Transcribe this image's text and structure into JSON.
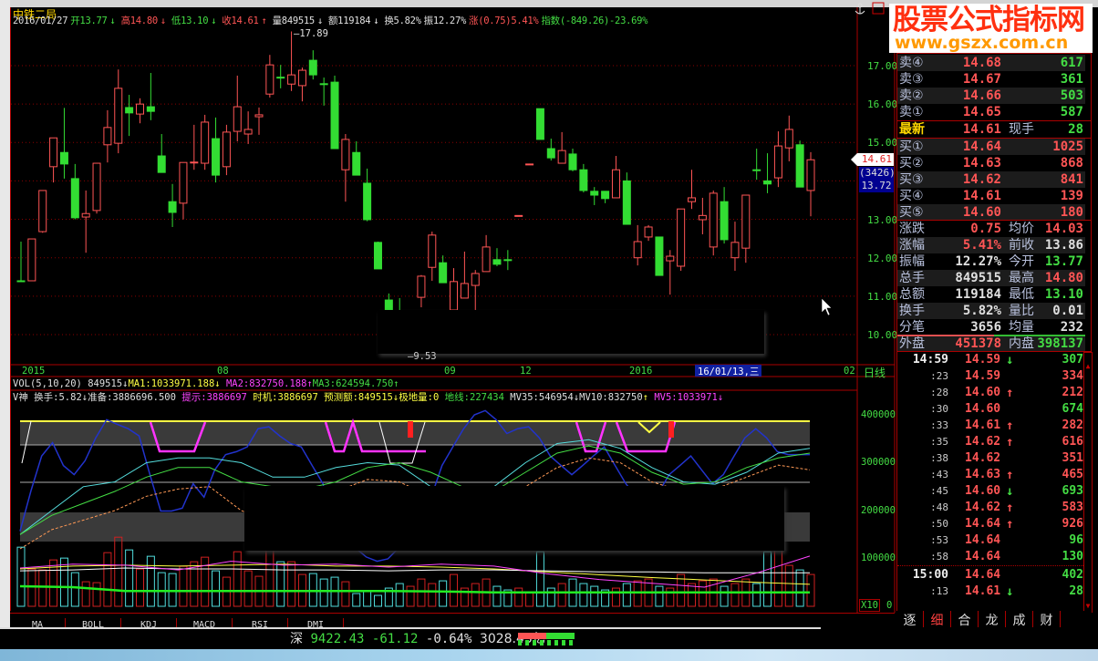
{
  "stock": {
    "name": "中铁二局"
  },
  "info": {
    "date": "2016/01/27",
    "open": "开13.77",
    "open_arrow": "↓",
    "high": "高14.80",
    "high_arrow": "↓",
    "low": "低13.10",
    "low_arrow": "↓",
    "close": "收14.61",
    "close_arrow": "↑",
    "vol": "量849515",
    "vol_arrow": "↓",
    "amt": "额119184",
    "amt_arrow": "↓",
    "turn": "换5.82%",
    "amp": "振12.27%",
    "chg": "涨(0.75)5.41%",
    "index": "指数(-849.26)-23.69%"
  },
  "price_axis": [
    "17.00",
    "16.00",
    "15.00",
    "13.00",
    "12.00",
    "11.00",
    "10.00"
  ],
  "price_tag": "14.61",
  "blue_tag": {
    "count": "(3426)",
    "price": "13.72"
  },
  "hi_label": "17.89",
  "lo_label": "9.53",
  "date_axis": [
    "2015",
    "08",
    "09",
    "12",
    "2016",
    "02"
  ],
  "date_selected": "16/01/13,三",
  "period": "日线",
  "vol_line": {
    "name": "VOL(5,10,20)",
    "value": "849515",
    "arrow": "↓",
    "ma1": "MA1:1033971.188",
    "ma1_arrow": "↓",
    "ma2": "MA2:832750.188",
    "ma2_arrow": "↑",
    "ma3": "MA3:624594.750",
    "ma3_arrow": "↑"
  },
  "ind_line": {
    "name": "V神",
    "turn": "换手:5.82",
    "turn_arrow": "↓",
    "prep": "准备:3886696.500",
    "hint": "提示:3886697",
    "timing": "时机:3886697",
    "forecast": "预测额:849515",
    "forecast_arrow": "↓",
    "extreme": "极地量:0",
    "ground": "地线:227434",
    "mv35": "MV35:546954",
    "mv35_arrow": "↓",
    "mv10": "MV10:832750",
    "mv10_arrow": "↑",
    "mv5": "MV5:1033971",
    "mv5_arrow": "↓"
  },
  "vol_axis": [
    "400000",
    "300000",
    "200000",
    "100000",
    "0"
  ],
  "vol_multiplier": "X10",
  "bottom_tabs": [
    "MA",
    "BOLL",
    "KDJ",
    "MACD",
    "RSI",
    "DMI"
  ],
  "status": {
    "market": "深",
    "index": "9422.43",
    "change": "-61.12",
    "pct": "-0.64%",
    "amount": "3028.43亿"
  },
  "logo": {
    "title": "股票公式指标网",
    "url": "www.gszx.com.cn"
  },
  "quote": {
    "asks": [
      {
        "label": "卖④",
        "price": "14.68",
        "vol": "617"
      },
      {
        "label": "卖③",
        "price": "14.67",
        "vol": "361"
      },
      {
        "label": "卖②",
        "price": "14.66",
        "vol": "503"
      },
      {
        "label": "卖①",
        "price": "14.65",
        "vol": "587"
      }
    ],
    "last": {
      "label": "最新",
      "price": "14.61",
      "label2": "现手",
      "vol": "28"
    },
    "bids": [
      {
        "label": "买①",
        "price": "14.64",
        "vol": "1025"
      },
      {
        "label": "买②",
        "price": "14.63",
        "vol": "868"
      },
      {
        "label": "买③",
        "price": "14.62",
        "vol": "841"
      },
      {
        "label": "买④",
        "price": "14.61",
        "vol": "139"
      },
      {
        "label": "买⑤",
        "price": "14.60",
        "vol": "180"
      }
    ],
    "stats": [
      {
        "l1": "涨跌",
        "v1": "0.75",
        "c1": "r",
        "l2": "均价",
        "v2": "14.03",
        "c2": "r"
      },
      {
        "l1": "涨幅",
        "v1": "5.41%",
        "c1": "r",
        "l2": "前收",
        "v2": "13.86",
        "c2": "w"
      },
      {
        "l1": "振幅",
        "v1": "12.27%",
        "c1": "w",
        "l2": "今开",
        "v2": "13.77",
        "c2": "g"
      },
      {
        "l1": "总手",
        "v1": "849515",
        "c1": "w",
        "l2": "最高",
        "v2": "14.80",
        "c2": "r"
      },
      {
        "l1": "总额",
        "v1": "119184",
        "c1": "w",
        "l2": "最低",
        "v2": "13.10",
        "c2": "g"
      },
      {
        "l1": "换手",
        "v1": "5.82%",
        "c1": "w",
        "l2": "量比",
        "v2": "0.01",
        "c2": "w"
      },
      {
        "l1": "分笔",
        "v1": "3656",
        "c1": "w",
        "l2": "均量",
        "v2": "232",
        "c2": "w"
      },
      {
        "l1": "外盘",
        "v1": "451378",
        "c1": "r",
        "l2": "内盘",
        "v2": "398137",
        "c2": "g"
      }
    ]
  },
  "ticks": [
    {
      "time": "14:59",
      "price": "14.59",
      "arrow": "↓",
      "vol": "307",
      "dir": "g"
    },
    {
      "time": ":23",
      "price": "14.59",
      "arrow": "",
      "vol": "334",
      "dir": "r"
    },
    {
      "time": ":28",
      "price": "14.60",
      "arrow": "↑",
      "vol": "212",
      "dir": "r"
    },
    {
      "time": ":30",
      "price": "14.60",
      "arrow": "",
      "vol": "674",
      "dir": "g"
    },
    {
      "time": ":33",
      "price": "14.61",
      "arrow": "↑",
      "vol": "282",
      "dir": "r"
    },
    {
      "time": ":35",
      "price": "14.62",
      "arrow": "↑",
      "vol": "616",
      "dir": "r"
    },
    {
      "time": ":38",
      "price": "14.62",
      "arrow": "",
      "vol": "351",
      "dir": "r"
    },
    {
      "time": ":43",
      "price": "14.63",
      "arrow": "↑",
      "vol": "465",
      "dir": "r"
    },
    {
      "time": ":45",
      "price": "14.60",
      "arrow": "↓",
      "vol": "693",
      "dir": "g"
    },
    {
      "time": ":48",
      "price": "14.62",
      "arrow": "↑",
      "vol": "583",
      "dir": "r"
    },
    {
      "time": ":50",
      "price": "14.64",
      "arrow": "↑",
      "vol": "926",
      "dir": "r"
    },
    {
      "time": ":53",
      "price": "14.64",
      "arrow": "",
      "vol": "96",
      "dir": "g"
    },
    {
      "time": ":58",
      "price": "14.64",
      "arrow": "",
      "vol": "130",
      "dir": "g"
    },
    {
      "time": "15:00",
      "price": "14.64",
      "arrow": "",
      "vol": "402",
      "dir": "g"
    },
    {
      "time": ":13",
      "price": "14.61",
      "arrow": "↓",
      "vol": "28",
      "dir": "g"
    }
  ],
  "right_tabs": [
    "逐",
    "细",
    "合",
    "龙",
    "成",
    "财"
  ],
  "colors": {
    "up": "#ff5555",
    "down": "#33dd33",
    "bg": "#000000",
    "grid": "#8a0000"
  },
  "chart_data": {
    "type": "candlestick",
    "ohlc": [
      [
        11.4,
        12.42,
        11.38,
        11.38
      ],
      [
        11.4,
        12.49,
        11.4,
        12.49
      ],
      [
        12.68,
        13.75,
        12.65,
        13.75
      ],
      [
        14.37,
        15.12,
        13.96,
        15.12
      ],
      [
        14.74,
        15.9,
        14.06,
        14.44
      ],
      [
        14.06,
        14.44,
        13.0,
        13.04
      ],
      [
        13.06,
        13.75,
        12.13,
        13.15
      ],
      [
        13.23,
        14.46,
        13.15,
        14.46
      ],
      [
        14.94,
        15.84,
        14.48,
        15.39
      ],
      [
        14.98,
        16.9,
        14.72,
        16.41
      ],
      [
        15.91,
        16.24,
        15.17,
        15.77
      ],
      [
        15.74,
        16.15,
        15.5,
        16.0
      ],
      [
        15.93,
        16.81,
        15.58,
        15.81
      ],
      [
        14.65,
        15.22,
        14.22,
        14.22
      ],
      [
        13.46,
        13.92,
        12.8,
        13.18
      ],
      [
        13.42,
        14.48,
        13.0,
        14.48
      ],
      [
        14.47,
        15.46,
        14.29,
        14.49
      ],
      [
        14.46,
        15.72,
        14.29,
        15.53
      ],
      [
        15.1,
        15.65,
        13.96,
        14.15
      ],
      [
        14.37,
        15.46,
        14.15,
        15.27
      ],
      [
        15.29,
        16.74,
        15.03,
        15.93
      ],
      [
        15.22,
        15.81,
        14.96,
        15.34
      ],
      [
        15.67,
        15.91,
        15.2,
        15.72
      ],
      [
        16.26,
        17.28,
        16.17,
        17.02
      ],
      [
        16.7,
        17.02,
        16.41,
        16.69
      ],
      [
        16.52,
        17.89,
        16.34,
        16.76
      ],
      [
        16.48,
        16.95,
        16.07,
        16.88
      ],
      [
        17.14,
        17.4,
        16.64,
        16.76
      ],
      [
        16.53,
        16.69,
        15.96,
        16.52
      ],
      [
        16.57,
        16.74,
        14.84,
        14.84
      ],
      [
        14.29,
        15.22,
        13.46,
        15.08
      ],
      [
        14.74,
        15.03,
        14.15,
        14.15
      ],
      [
        13.94,
        14.32,
        12.95,
        12.99
      ],
      [
        12.4,
        12.42,
        11.71,
        11.71
      ],
      [
        10.9,
        11.07,
        10.0,
        10.2
      ],
      [
        10.3,
        10.95,
        9.8,
        9.9
      ],
      [
        9.9,
        10.5,
        9.53,
        10.4
      ],
      [
        10.97,
        11.55,
        10.71,
        11.52
      ],
      [
        11.75,
        12.68,
        11.4,
        12.59
      ],
      [
        11.87,
        12.06,
        11.35,
        11.35
      ],
      [
        10.64,
        11.73,
        10.64,
        11.38
      ],
      [
        10.95,
        12.16,
        10.95,
        11.33
      ],
      [
        11.28,
        11.68,
        10.64,
        11.59
      ],
      [
        11.64,
        12.59,
        11.64,
        12.28
      ],
      [
        11.95,
        12.25,
        11.78,
        11.83
      ],
      [
        11.95,
        12.2,
        11.68,
        11.94
      ],
      [
        13.1,
        13.1,
        13.1,
        13.1
      ],
      [
        14.44,
        14.44,
        14.44,
        14.44
      ],
      [
        15.88,
        15.88,
        15.08,
        15.08
      ],
      [
        14.84,
        15.1,
        14.53,
        14.6
      ],
      [
        14.46,
        15.27,
        14.46,
        14.79
      ],
      [
        14.7,
        14.84,
        14.25,
        14.29
      ],
      [
        14.29,
        14.44,
        13.7,
        13.75
      ],
      [
        13.73,
        13.84,
        13.37,
        13.63
      ],
      [
        13.73,
        13.73,
        13.42,
        13.54
      ],
      [
        13.56,
        14.65,
        13.56,
        14.29
      ],
      [
        14.0,
        14.22,
        12.87,
        12.87
      ],
      [
        12.0,
        12.85,
        11.8,
        12.42
      ],
      [
        12.54,
        12.85,
        12.44,
        12.8
      ],
      [
        12.54,
        12.54,
        11.54,
        11.54
      ],
      [
        11.92,
        12.2,
        11.04,
        12.04
      ],
      [
        11.78,
        13.27,
        11.66,
        13.27
      ],
      [
        13.46,
        14.29,
        13.27,
        13.56
      ],
      [
        12.99,
        13.56,
        12.61,
        13.1
      ],
      [
        12.28,
        13.75,
        12.06,
        13.68
      ],
      [
        13.46,
        13.84,
        12.37,
        12.47
      ],
      [
        12.0,
        12.94,
        11.66,
        12.4
      ],
      [
        12.25,
        13.63,
        11.87,
        13.63
      ],
      [
        14.29,
        14.84,
        14.03,
        14.28
      ],
      [
        14.0,
        14.72,
        13.68,
        13.92
      ],
      [
        14.08,
        15.29,
        13.84,
        14.91
      ],
      [
        14.86,
        15.7,
        14.51,
        15.34
      ],
      [
        14.94,
        15.05,
        13.84,
        13.84
      ],
      [
        13.75,
        14.75,
        13.08,
        14.55
      ]
    ],
    "ylim": [
      9.5,
      17.9
    ],
    "volume": [
      123500,
      77900,
      76000,
      96900,
      100700,
      70300,
      51300,
      49400,
      112100,
      144400,
      117800,
      77900,
      104500,
      70300,
      68400,
      83600,
      93100,
      102600,
      74100,
      60800,
      114000,
      74100,
      62700,
      117800,
      93100,
      93100,
      66500,
      68400,
      57000,
      60800,
      51300,
      26600,
      32300,
      22800,
      38000,
      47500,
      41800,
      57000,
      47500,
      53200,
      66500,
      38000,
      47500,
      57000,
      41800,
      34200,
      38000,
      28500,
      114000,
      38000,
      47500,
      57000,
      47500,
      41800,
      34200,
      38000,
      47500,
      53200,
      57000,
      41800,
      38000,
      66500,
      47500,
      53200,
      57000,
      41800,
      47500,
      57000,
      47500,
      114000,
      123500,
      85500,
      76000,
      66500
    ],
    "vol_ylim": [
      0,
      400000
    ],
    "vol_ma": [
      {
        "name": "MA1",
        "color": "#ffff44",
        "values": [
          78000,
          84000,
          86000,
          84000,
          86000,
          88000,
          84000,
          84000,
          82000,
          78000,
          72000,
          66000,
          60000,
          55000,
          50000,
          46000
        ]
      },
      {
        "name": "MA2",
        "color": "#ffffff",
        "values": [
          74000,
          76000,
          80000,
          78000,
          78000,
          76000,
          76000,
          74000,
          76000,
          76000,
          74000,
          72000,
          72000,
          70000,
          70000,
          70000
        ]
      },
      {
        "name": "MA3",
        "color": "#ff44ff",
        "values": [
          80000,
          88000,
          86000,
          76000,
          94000,
          86000,
          88000,
          82000,
          88000,
          84000,
          68000,
          56000,
          48000,
          40000,
          70000,
          105000
        ]
      },
      {
        "name": "MV35",
        "color": "#22ee22",
        "values": [
          42000,
          40000,
          32000,
          32000,
          32000,
          32000,
          32000,
          32000,
          31000,
          29000,
          29000,
          29000,
          29000,
          29000,
          29000,
          29000
        ]
      }
    ],
    "ind_lines": [
      {
        "name": "blue",
        "color": "#2233cc",
        "values": [
          157000,
          241000,
          314000,
          342000,
          294000,
          275000,
          304000,
          352000,
          390000,
          380000,
          371000,
          356000,
          275000,
          199000,
          199000,
          205000,
          256000,
          228000,
          285000,
          317000,
          323000,
          333000,
          371000,
          375000,
          356000,
          340000,
          333000,
          294000,
          256000,
          161000,
          141000,
          122000,
          103000,
          94000,
          99000,
          122000,
          141000,
          180000,
          228000,
          294000,
          333000,
          371000,
          400000,
          409000,
          390000,
          361000,
          371000,
          375000,
          352000,
          314000,
          294000,
          275000,
          294000,
          314000,
          333000,
          294000,
          256000,
          228000,
          218000,
          237000,
          275000,
          294000,
          314000,
          285000,
          256000,
          275000,
          314000,
          352000,
          371000,
          352000,
          323000,
          317000,
          317000,
          317000
        ]
      },
      {
        "name": "cyan",
        "color": "#55dddd",
        "values": [
          150000,
          200000,
          250000,
          260000,
          300000,
          310000,
          310000,
          300000,
          270000,
          270000,
          290000,
          300000,
          295000,
          250000,
          230000,
          250000,
          300000,
          340000,
          348000,
          330000,
          290000,
          260000,
          255000,
          280000,
          320000,
          330000
        ]
      },
      {
        "name": "green",
        "color": "#44dd44",
        "values": [
          150000,
          190000,
          215000,
          240000,
          270000,
          290000,
          290000,
          260000,
          250000,
          245000,
          260000,
          290000,
          300000,
          280000,
          250000,
          240000,
          280000,
          320000,
          335000,
          320000,
          280000,
          255000,
          260000,
          290000,
          310000,
          320000
        ]
      },
      {
        "name": "orange",
        "color": "#ff9955",
        "values": [
          120000,
          160000,
          180000,
          200000,
          230000,
          245000,
          250000,
          200000,
          175000,
          200000,
          240000,
          265000,
          260000,
          230000,
          210000,
          220000,
          250000,
          290000,
          310000,
          300000,
          260000,
          240000,
          245000,
          270000,
          295000,
          285000
        ]
      }
    ]
  }
}
